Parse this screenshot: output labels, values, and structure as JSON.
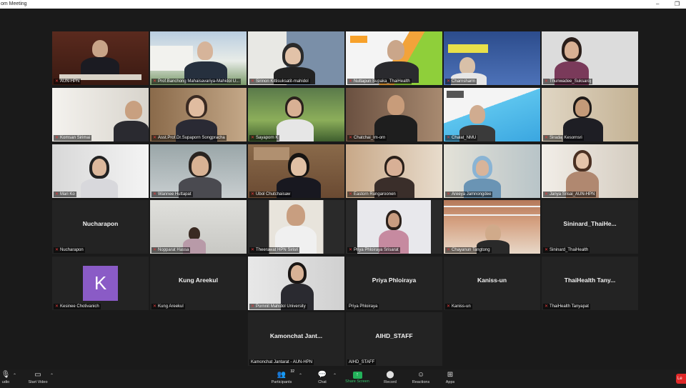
{
  "window": {
    "title": "om Meeting"
  },
  "participants": [
    "AUN-HPN",
    "Prof.Banchong Mahaisavariya-Mahidol U...",
    "Sirinon Kittisuksatit-mahidol",
    "Nuttapun Supaka_ThaiHealth",
    "Charnsharm",
    "Thunwadee_Suksaroj",
    "Komsan Sirimai",
    "Asst.Prof.Dr.Supaporn Songpracha",
    "Sayaporn K",
    "Chatchai_Im-orn",
    "Chalat_NMU",
    "Siradaj Kesornsri",
    "Mari Ko",
    "Wannee Huttapat",
    "Ubol Chutchaisaw",
    "Eastorn Rungaroonen",
    "Areeya Jamnongdee",
    "Janya Srisai_AUN-HPN",
    "Nucharapon",
    "Nopparat Hassa",
    "Theerawat HPN Sirisri",
    "Priya Phloiraya Srisarat",
    "Chayanun Tangtong",
    "Sininard_ThaiHealth",
    "Kesinee Chotivanich",
    "Kung Areekul",
    "Pornnit Mahidol University",
    "Priya Phloiraya",
    "Kaniss-un",
    "ThaiHealth Tanyapat",
    "Kamonchat Jantarat - AUN-HPN",
    "AIHD_STAFF"
  ],
  "name_only_tiles": {
    "nucharapon": "Nucharapon",
    "sininard": "Sininard_ThaiHe...",
    "kung": "Kung Areekul",
    "priya": "Priya Phloiraya",
    "kaniss": "Kaniss-un",
    "thaihealth": "ThaiHealth Tany...",
    "kamonchat": "Kamonchat  Jant...",
    "aihd": "AIHD_STAFF"
  },
  "avatar_letter": "K",
  "toolbar": {
    "audio": "udio",
    "start_video": "Start Video",
    "participants": "Participants",
    "participant_count": "32",
    "chat": "Chat",
    "share_screen": "Share Screen",
    "record": "Record",
    "reactions": "Reactions",
    "apps": "Apps",
    "leave": "Le"
  },
  "colors": {
    "accent_green": "#23b15a",
    "leave_red": "#e02828",
    "active_speaker": "#d6d64a",
    "avatar_purple": "#8a5bc6"
  }
}
